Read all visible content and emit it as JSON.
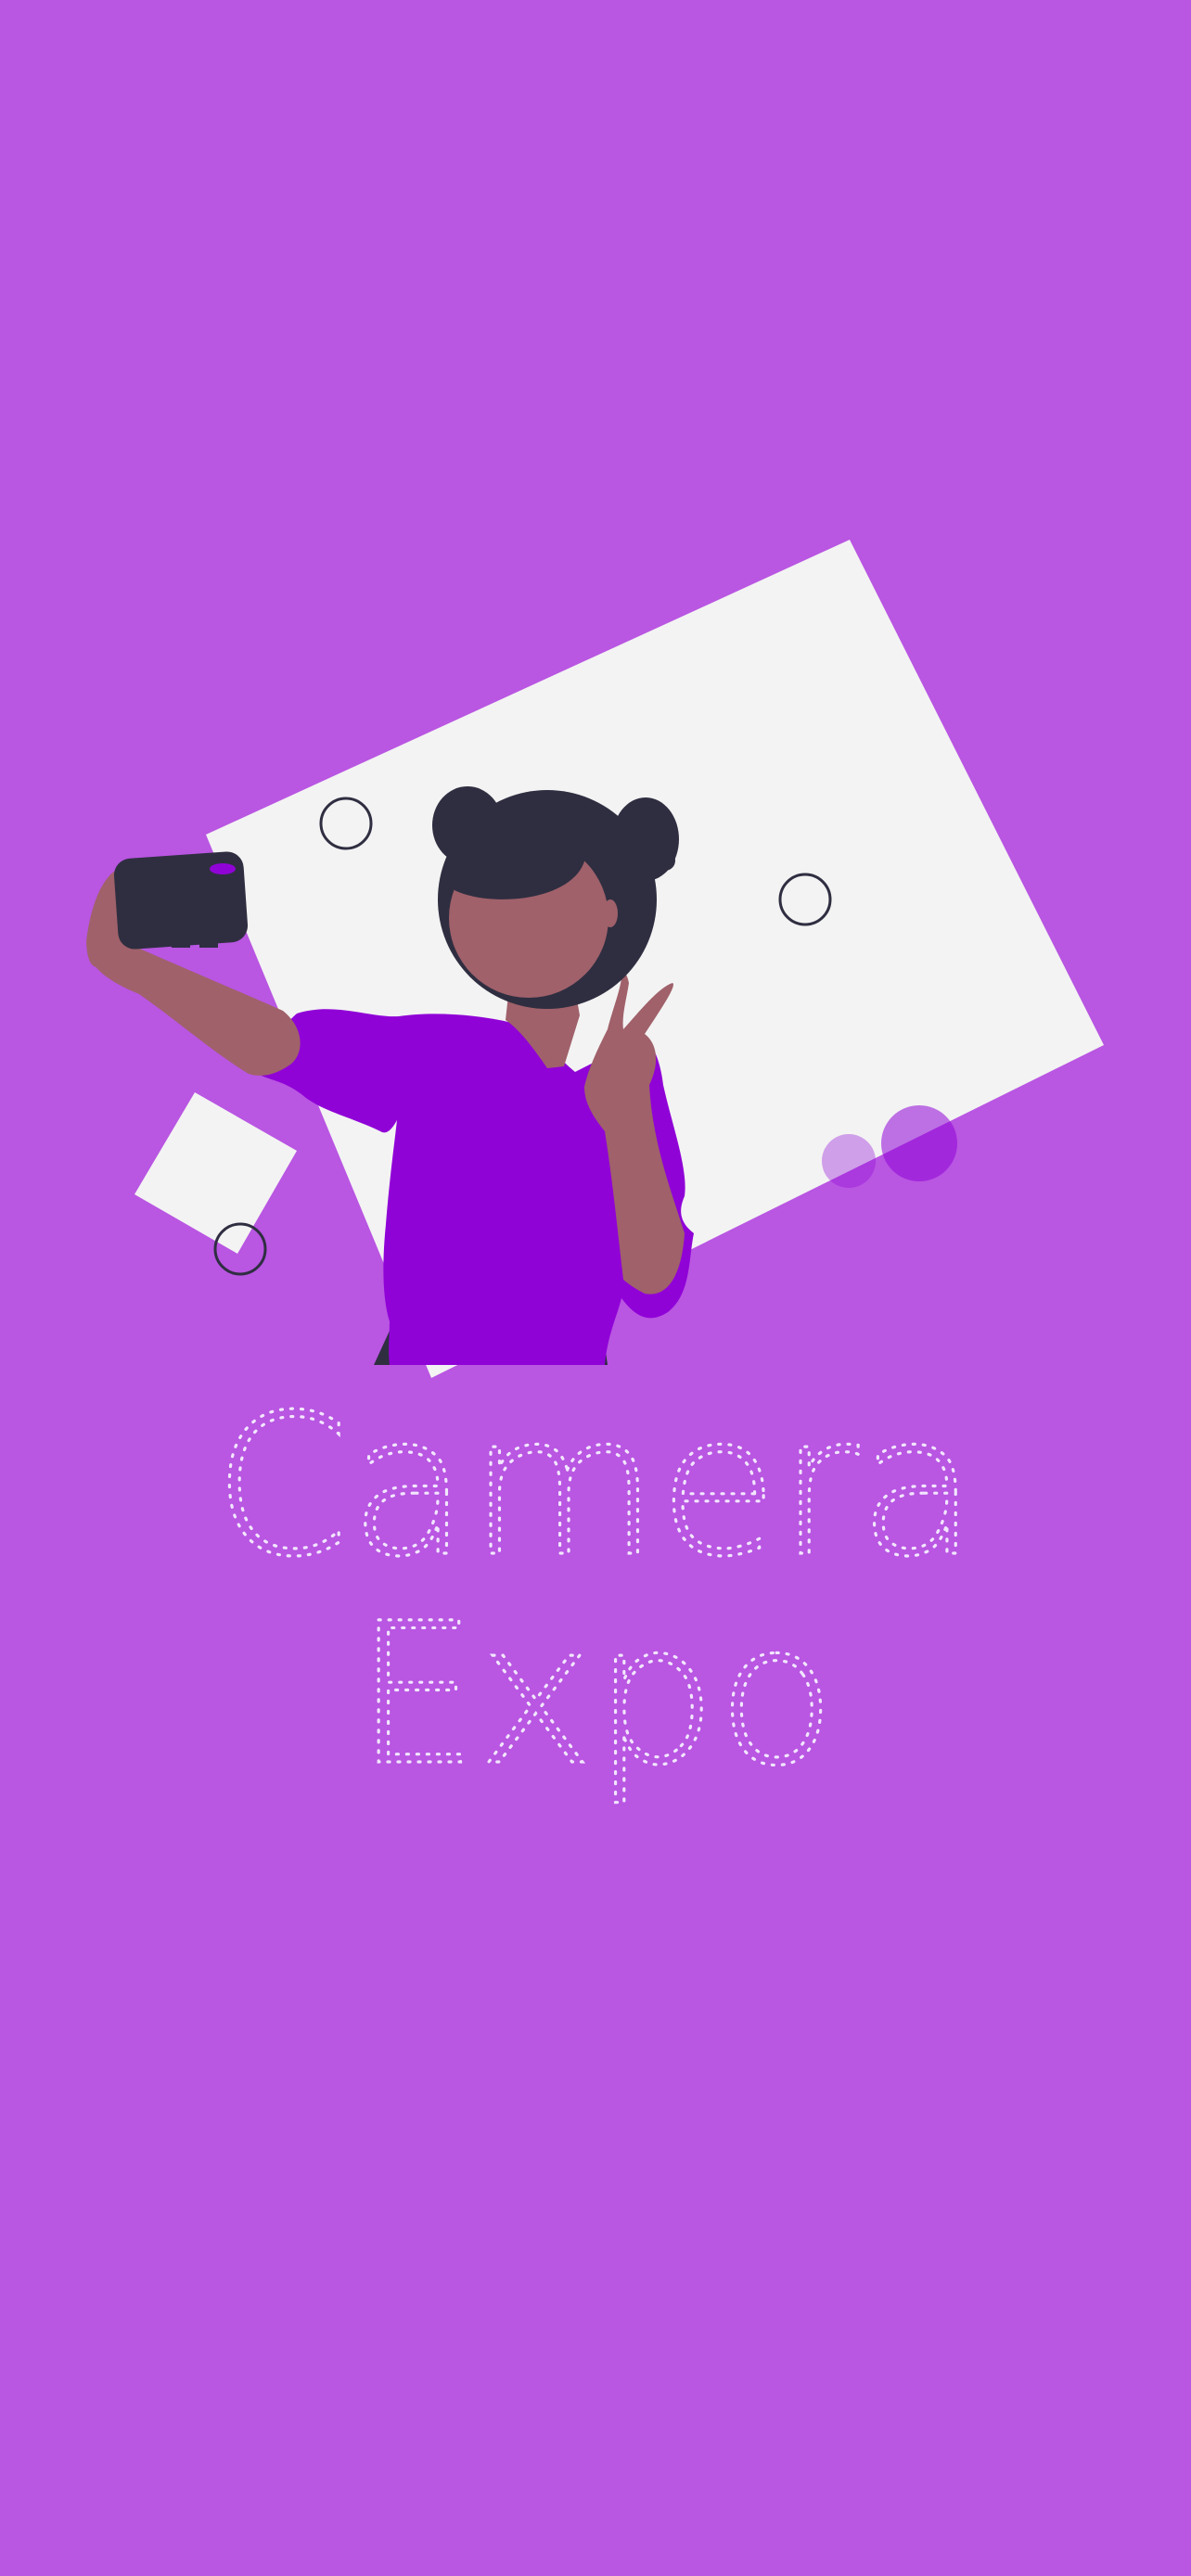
{
  "app": {
    "title_line1": "Camera",
    "title_line2": "Expo"
  },
  "colors": {
    "background": "#b956e2",
    "card": "#f3f3f3",
    "dark": "#2f2e41",
    "shirt": "#9003d7",
    "skin": "#a0616a",
    "title_dots": "#f2e6ff"
  },
  "icons": {
    "illustration": "selfie-person-illustration",
    "camera": "phone-camera-icon"
  }
}
